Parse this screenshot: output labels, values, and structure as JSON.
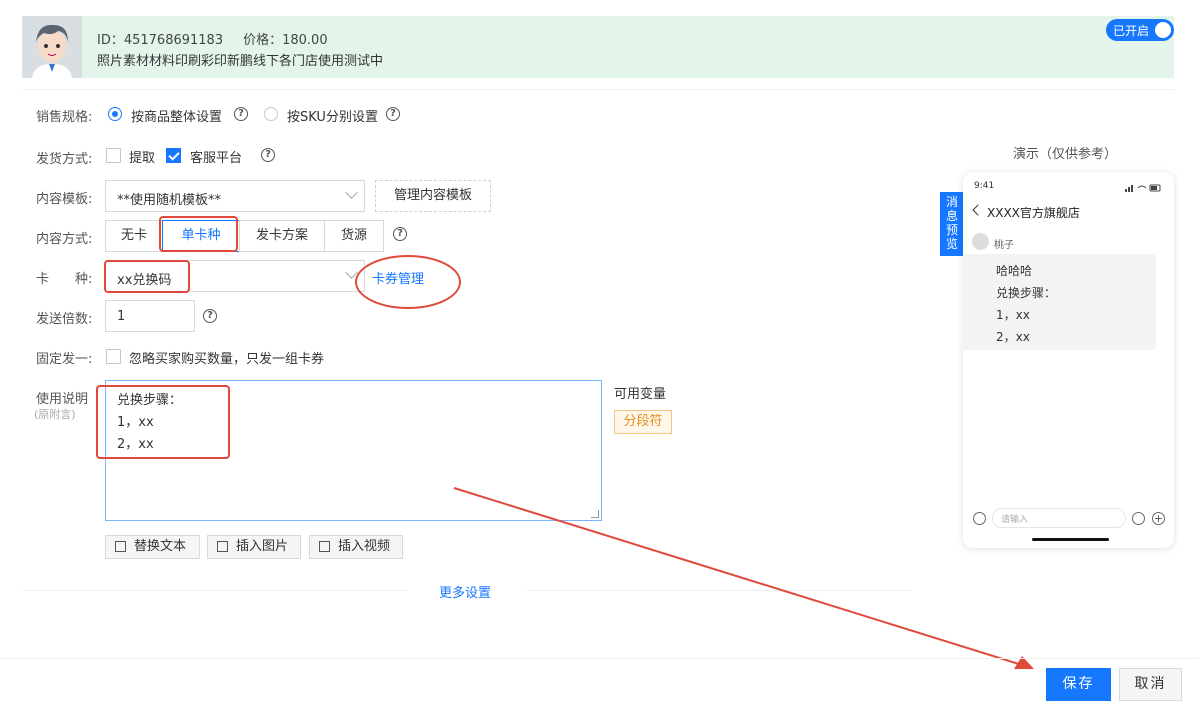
{
  "product": {
    "id_text": "ID：451768691183",
    "price_text": "价格：180.00",
    "name": "照片素材材料印刷彩印新鹏线下各门店使用测试中",
    "toggle_label": "已开启"
  },
  "form": {
    "spec_label": "销售规格:",
    "spec_options": [
      "按商品整体设置",
      "按SKU分别设置"
    ],
    "ship_label": "发货方式:",
    "ship_options": [
      "提取",
      "客服平台"
    ],
    "template_label": "内容模板:",
    "template_value": "**使用随机模板**",
    "manage_template": "管理内容模板",
    "content_mode_label": "内容方式:",
    "content_modes": [
      "无卡",
      "单卡种",
      "发卡方案",
      "货源"
    ],
    "card_type_label": "卡　　种:",
    "card_type_value": "xx兑换码",
    "card_manage_link": "卡券管理",
    "multiplier_label": "发送倍数:",
    "multiplier_value": "1",
    "fixed_label": "固定发一:",
    "fixed_text": "忽略买家购买数量，只发一组卡券",
    "usage_label": "使用说明",
    "usage_sub": "(原附言)",
    "usage_lines": [
      "兑换步骤：",
      "1，xx",
      "2，xx"
    ],
    "variables_label": "可用变量",
    "variable_tag": "分段符",
    "tools": [
      "替换文本",
      "插入图片",
      "插入视频"
    ],
    "more_settings": "更多设置"
  },
  "preview": {
    "title": "演示（仅供参考）",
    "tab": [
      "消",
      "息",
      "预",
      "览"
    ],
    "time": "9:41",
    "shop": "XXXX官方旗舰店",
    "user": "桃子",
    "bubble_lines": [
      "哈哈哈",
      "兑换步骤：",
      "1，xx",
      "2，xx"
    ],
    "input_placeholder": "请输入"
  },
  "actions": {
    "save": "保存",
    "cancel": "取消"
  },
  "colors": {
    "accent": "#1677ff",
    "annotation": "#e04a3a",
    "header_bg": "#e3f5ea"
  }
}
